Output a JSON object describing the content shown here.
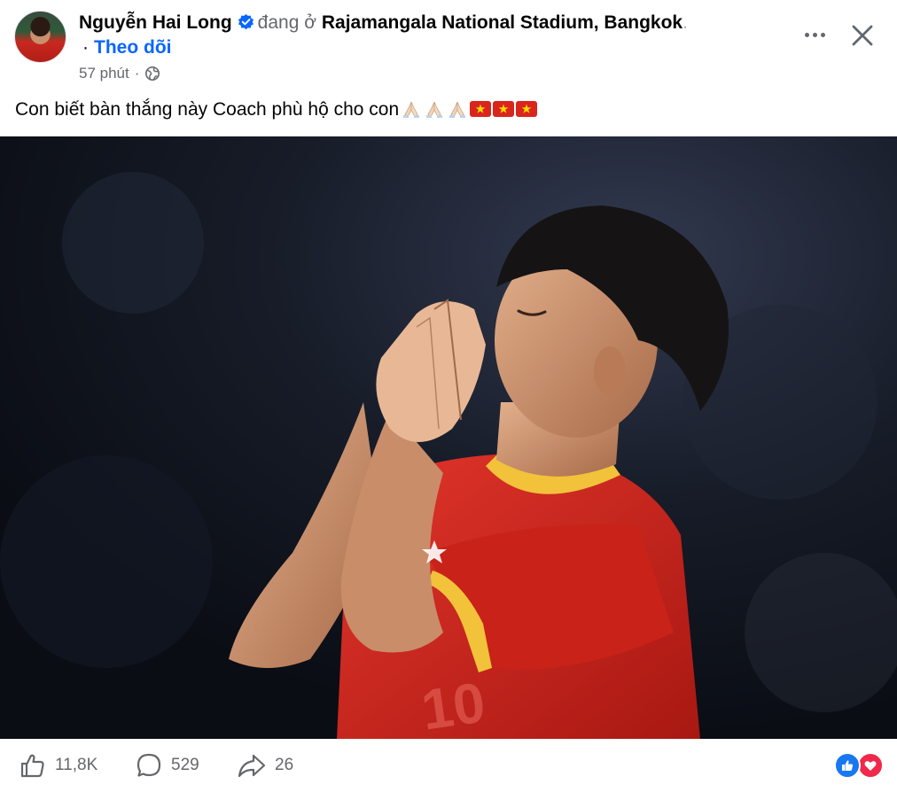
{
  "post": {
    "author_name": "Nguyễn Hai Long",
    "location_prefix": "đang ở",
    "location": "Rajamangala National Stadium, Bangkok",
    "location_suffix": ".",
    "follow_dot": "·",
    "follow_label": "Theo dõi",
    "time": "57 phút",
    "meta_sep": "·",
    "audience_icon": "globe-icon",
    "caption_text": "Con biết bàn thắng này Coach phù hộ cho con",
    "caption_emojis": [
      "🙏",
      "🙏",
      "🙏",
      "🇻🇳",
      "🇻🇳",
      "🇻🇳"
    ]
  },
  "header_actions": {
    "more_icon": "more-horizontal-icon",
    "close_icon": "close-icon"
  },
  "stats": {
    "likes": "11,8K",
    "comments": "529",
    "shares": "26",
    "reaction_icons": [
      "like-reaction-icon",
      "love-reaction-icon"
    ]
  },
  "colors": {
    "link_blue": "#0866ff",
    "verified_blue": "#0866ff",
    "secondary_text": "#65676b",
    "jersey_red": "#d2231c",
    "jersey_trim": "#f2c23a",
    "love_red": "#f0284a"
  }
}
